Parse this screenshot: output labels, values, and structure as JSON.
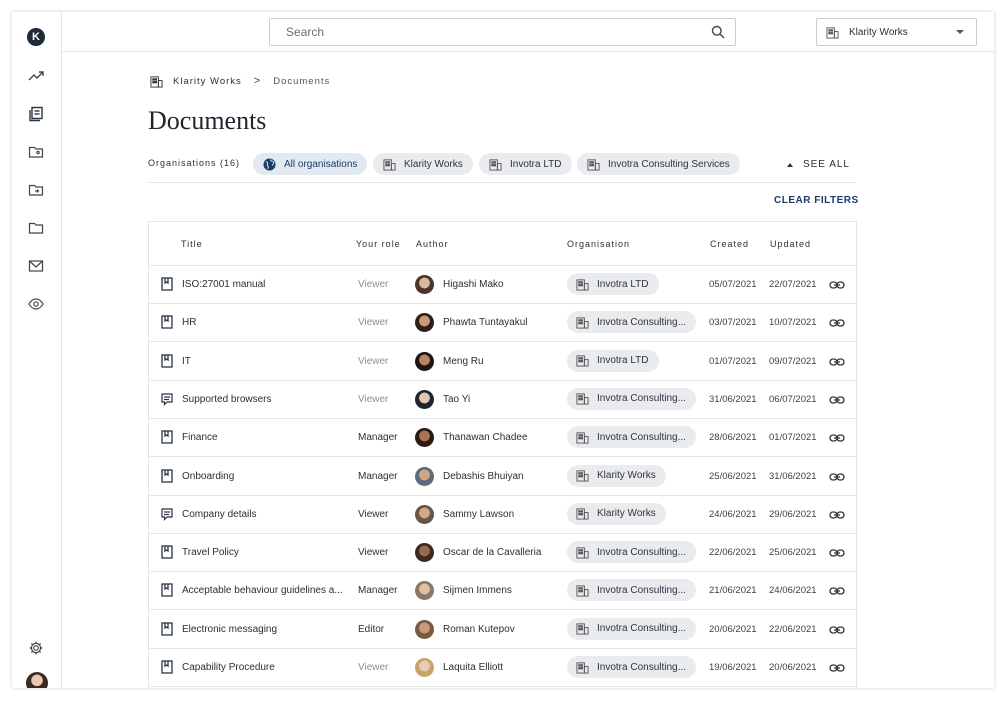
{
  "sidebar": {
    "logo_letter": "K",
    "icons": [
      "trending-icon",
      "documents-icon",
      "folder-user-icon",
      "folder-arrow-icon",
      "folder-icon",
      "mail-icon",
      "eye-icon",
      "gear-icon"
    ]
  },
  "topbar": {
    "search_placeholder": "Search",
    "org_select": "Klarity Works"
  },
  "breadcrumb": {
    "root": "Klarity Works",
    "separator": ">",
    "current": "Documents"
  },
  "page_title": "Documents",
  "filters": {
    "label": "Organisations (16)",
    "chips": [
      "All organisations",
      "Klarity Works",
      "Invotra LTD",
      "Invotra Consulting Services"
    ],
    "see_all": "SEE ALL",
    "clear": "CLEAR FILTERS"
  },
  "table": {
    "columns": {
      "title": "Title",
      "role": "Your role",
      "author": "Author",
      "organisation": "Organisation",
      "created": "Created",
      "updated": "Updated"
    },
    "rows": [
      {
        "title": "ISO:27001 manual",
        "role": "Viewer",
        "role_muted": true,
        "author": "Higashi Mako",
        "org": "Invotra LTD",
        "created": "05/07/2021",
        "updated": "22/07/2021",
        "icon": "book"
      },
      {
        "title": "HR",
        "role": "Viewer",
        "role_muted": true,
        "author": "Phawta Tuntayakul",
        "org": "Invotra Consulting...",
        "created": "03/07/2021",
        "updated": "10/07/2021",
        "icon": "book"
      },
      {
        "title": "IT",
        "role": "Viewer",
        "role_muted": true,
        "author": "Meng Ru",
        "org": "Invotra LTD",
        "created": "01/07/2021",
        "updated": "09/07/2021",
        "icon": "book"
      },
      {
        "title": "Supported browsers",
        "role": "Viewer",
        "role_muted": true,
        "author": "Tao Yi",
        "org": "Invotra Consulting...",
        "created": "31/06/2021",
        "updated": "06/07/2021",
        "icon": "page"
      },
      {
        "title": "Finance",
        "role": "Manager",
        "role_muted": false,
        "author": "Thanawan Chadee",
        "org": "Invotra Consulting...",
        "created": "28/06/2021",
        "updated": "01/07/2021",
        "icon": "book"
      },
      {
        "title": "Onboarding",
        "role": "Manager",
        "role_muted": false,
        "author": "Debashis Bhuiyan",
        "org": "Klarity Works",
        "created": "25/06/2021",
        "updated": "31/06/2021",
        "icon": "book"
      },
      {
        "title": "Company details",
        "role": "Viewer",
        "role_muted": false,
        "author": "Sammy Lawson",
        "org": "Klarity Works",
        "created": "24/06/2021",
        "updated": "29/06/2021",
        "icon": "page"
      },
      {
        "title": "Travel Policy",
        "role": "Viewer",
        "role_muted": false,
        "author": "Oscar de la Cavalleria",
        "org": "Invotra Consulting...",
        "created": "22/06/2021",
        "updated": "25/06/2021",
        "icon": "book"
      },
      {
        "title": "Acceptable behaviour guidelines a...",
        "role": "Manager",
        "role_muted": false,
        "author": "Sijmen Immens",
        "org": "Invotra Consulting...",
        "created": "21/06/2021",
        "updated": "24/06/2021",
        "icon": "book"
      },
      {
        "title": "Electronic messaging",
        "role": "Editor",
        "role_muted": false,
        "author": "Roman Kutepov",
        "org": "Invotra Consulting...",
        "created": "20/06/2021",
        "updated": "22/06/2021",
        "icon": "book"
      },
      {
        "title": "Capability Procedure",
        "role": "Viewer",
        "role_muted": true,
        "author": "Laquita Elliott",
        "org": "Invotra Consulting...",
        "created": "19/06/2021",
        "updated": "20/06/2021",
        "icon": "book"
      }
    ]
  },
  "colors": {
    "accent": "#1c3b6b",
    "chip_bg": "#e9ebee",
    "border": "#e3e5e8",
    "text": "#2a2f36"
  }
}
